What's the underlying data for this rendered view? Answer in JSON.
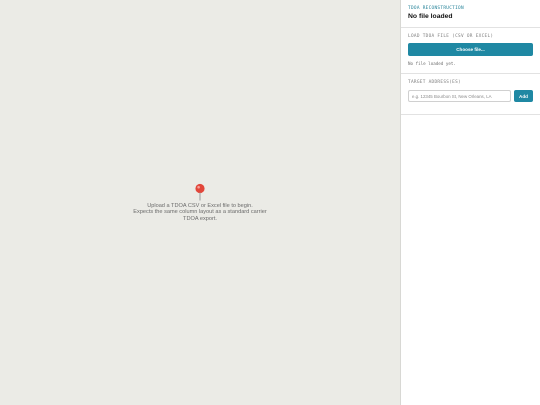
{
  "empty_state": {
    "icon": "pin-icon",
    "lines": [
      "Upload a TDOA CSV or Excel file to begin.",
      "Expects the same column layout as a standard carrier",
      "TDOA export."
    ]
  },
  "sidebar": {
    "header": {
      "eyebrow": "TDOA RECONSTRUCTION",
      "title": "No file loaded"
    },
    "load": {
      "label": "LOAD TDOA FILE (CSV OR EXCEL)",
      "button": "Choose file...",
      "status": "No file loaded yet."
    },
    "target": {
      "label": "TARGET ADDRESS(ES)",
      "placeholder": "e.g. 12345 Bourbon St, New Orleans, LA",
      "button": "Add"
    }
  },
  "colors": {
    "accent": "#1f88a3",
    "map_bg": "#ebebe6",
    "pin": "#e2463a"
  }
}
